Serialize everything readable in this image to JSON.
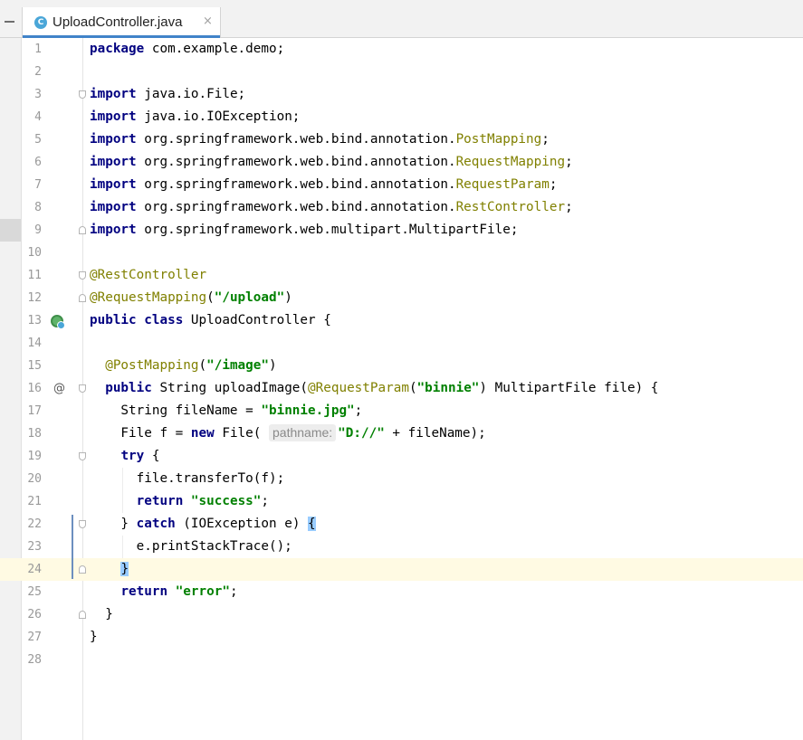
{
  "tab": {
    "icon": "class-c-icon",
    "icon_letter": "C",
    "label": "UploadController.java",
    "close_glyph": "×"
  },
  "editor": {
    "current_line": 24,
    "lines": [
      {
        "n": "1",
        "segments": [
          {
            "t": "package",
            "c": "kw"
          },
          {
            "t": " com.example.demo;",
            "c": ""
          }
        ]
      },
      {
        "n": "2",
        "segments": []
      },
      {
        "n": "3",
        "segments": [
          {
            "t": "import",
            "c": "kw"
          },
          {
            "t": " java.io.File;",
            "c": ""
          }
        ]
      },
      {
        "n": "4",
        "segments": [
          {
            "t": "import",
            "c": "kw"
          },
          {
            "t": " java.io.IOException;",
            "c": ""
          }
        ]
      },
      {
        "n": "5",
        "segments": [
          {
            "t": "import",
            "c": "kw"
          },
          {
            "t": " org.springframework.web.bind.annotation.",
            "c": ""
          },
          {
            "t": "PostMapping",
            "c": "ann"
          },
          {
            "t": ";",
            "c": ""
          }
        ]
      },
      {
        "n": "6",
        "segments": [
          {
            "t": "import",
            "c": "kw"
          },
          {
            "t": " org.springframework.web.bind.annotation.",
            "c": ""
          },
          {
            "t": "RequestMapping",
            "c": "ann"
          },
          {
            "t": ";",
            "c": ""
          }
        ]
      },
      {
        "n": "7",
        "segments": [
          {
            "t": "import",
            "c": "kw"
          },
          {
            "t": " org.springframework.web.bind.annotation.",
            "c": ""
          },
          {
            "t": "RequestParam",
            "c": "ann"
          },
          {
            "t": ";",
            "c": ""
          }
        ]
      },
      {
        "n": "8",
        "segments": [
          {
            "t": "import",
            "c": "kw"
          },
          {
            "t": " org.springframework.web.bind.annotation.",
            "c": ""
          },
          {
            "t": "RestController",
            "c": "ann"
          },
          {
            "t": ";",
            "c": ""
          }
        ]
      },
      {
        "n": "9",
        "segments": [
          {
            "t": "import",
            "c": "kw"
          },
          {
            "t": " org.springframework.web.multipart.MultipartFile;",
            "c": ""
          }
        ]
      },
      {
        "n": "10",
        "segments": []
      },
      {
        "n": "11",
        "segments": [
          {
            "t": "@RestController",
            "c": "ann"
          }
        ]
      },
      {
        "n": "12",
        "segments": [
          {
            "t": "@RequestMapping",
            "c": "ann"
          },
          {
            "t": "(",
            "c": ""
          },
          {
            "t": "\"/upload\"",
            "c": "str"
          },
          {
            "t": ")",
            "c": ""
          }
        ]
      },
      {
        "n": "13",
        "segments": [
          {
            "t": "public",
            "c": "kw"
          },
          {
            "t": " ",
            "c": ""
          },
          {
            "t": "class",
            "c": "kw"
          },
          {
            "t": " UploadController {",
            "c": ""
          }
        ]
      },
      {
        "n": "14",
        "segments": []
      },
      {
        "n": "15",
        "segments": [
          {
            "t": "  ",
            "c": ""
          },
          {
            "t": "@PostMapping",
            "c": "ann"
          },
          {
            "t": "(",
            "c": ""
          },
          {
            "t": "\"/image\"",
            "c": "str"
          },
          {
            "t": ")",
            "c": ""
          }
        ]
      },
      {
        "n": "16",
        "segments": [
          {
            "t": "  ",
            "c": ""
          },
          {
            "t": "public",
            "c": "kw"
          },
          {
            "t": " String uploadImage(",
            "c": ""
          },
          {
            "t": "@RequestParam",
            "c": "ann"
          },
          {
            "t": "(",
            "c": ""
          },
          {
            "t": "\"binnie\"",
            "c": "str"
          },
          {
            "t": ") MultipartFile file) {",
            "c": ""
          }
        ]
      },
      {
        "n": "17",
        "segments": [
          {
            "t": "    String fileName = ",
            "c": ""
          },
          {
            "t": "\"binnie.jpg\"",
            "c": "str"
          },
          {
            "t": ";",
            "c": ""
          }
        ]
      },
      {
        "n": "18",
        "segments": [
          {
            "t": "    File f = ",
            "c": ""
          },
          {
            "t": "new",
            "c": "kw"
          },
          {
            "t": " File( ",
            "c": ""
          },
          {
            "t": "pathname:",
            "c": "hint"
          },
          {
            "t": "\"D://\"",
            "c": "str"
          },
          {
            "t": " + fileName);",
            "c": ""
          }
        ]
      },
      {
        "n": "19",
        "segments": [
          {
            "t": "    ",
            "c": ""
          },
          {
            "t": "try",
            "c": "kw"
          },
          {
            "t": " {",
            "c": ""
          }
        ]
      },
      {
        "n": "20",
        "segments": [
          {
            "t": "      file.transferTo(f);",
            "c": ""
          }
        ]
      },
      {
        "n": "21",
        "segments": [
          {
            "t": "      ",
            "c": ""
          },
          {
            "t": "return",
            "c": "kw"
          },
          {
            "t": " ",
            "c": ""
          },
          {
            "t": "\"success\"",
            "c": "str"
          },
          {
            "t": ";",
            "c": ""
          }
        ]
      },
      {
        "n": "22",
        "segments": [
          {
            "t": "    } ",
            "c": ""
          },
          {
            "t": "catch",
            "c": "kw"
          },
          {
            "t": " (IOException e) ",
            "c": ""
          },
          {
            "t": "{",
            "c": "brace"
          }
        ]
      },
      {
        "n": "23",
        "segments": [
          {
            "t": "      e.printStackTrace();",
            "c": ""
          }
        ]
      },
      {
        "n": "24",
        "segments": [
          {
            "t": "    ",
            "c": ""
          },
          {
            "t": "}",
            "c": "brace"
          }
        ]
      },
      {
        "n": "25",
        "segments": [
          {
            "t": "    ",
            "c": ""
          },
          {
            "t": "return",
            "c": "kw"
          },
          {
            "t": " ",
            "c": ""
          },
          {
            "t": "\"error\"",
            "c": "str"
          },
          {
            "t": ";",
            "c": ""
          }
        ]
      },
      {
        "n": "26",
        "segments": [
          {
            "t": "  }",
            "c": ""
          }
        ]
      },
      {
        "n": "27",
        "segments": [
          {
            "t": "}",
            "c": ""
          }
        ]
      },
      {
        "n": "28",
        "segments": []
      }
    ],
    "gutter_markers": [
      {
        "line": 13,
        "icon": "spring-bean-icon"
      },
      {
        "line": 16,
        "icon": "at-override-icon",
        "glyph": "@"
      }
    ],
    "fold_markers": [
      {
        "line": 3,
        "dir": "down"
      },
      {
        "line": 9,
        "dir": "up"
      },
      {
        "line": 11,
        "dir": "down"
      },
      {
        "line": 12,
        "dir": "up"
      },
      {
        "line": 16,
        "dir": "down"
      },
      {
        "line": 19,
        "dir": "down"
      },
      {
        "line": 22,
        "dir": "down"
      },
      {
        "line": 24,
        "dir": "up"
      },
      {
        "line": 26,
        "dir": "up"
      }
    ]
  }
}
